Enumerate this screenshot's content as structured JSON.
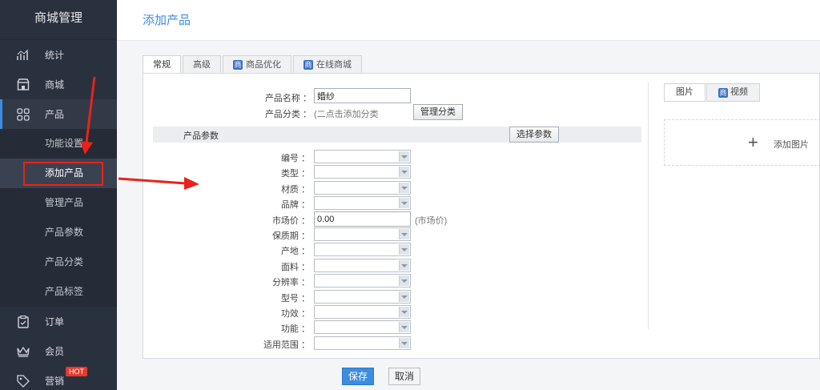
{
  "brand": "商城管理",
  "sidebar": {
    "items": [
      {
        "label": "统计",
        "icon": "chart-icon"
      },
      {
        "label": "商城",
        "icon": "store-icon"
      },
      {
        "label": "产品",
        "icon": "grid-icon"
      },
      {
        "label": "订单",
        "icon": "clipboard-icon"
      },
      {
        "label": "会员",
        "icon": "crown-icon"
      },
      {
        "label": "营销",
        "icon": "tag-icon",
        "badge": "HOT"
      }
    ],
    "sub_items": [
      "功能设置",
      "添加产品",
      "管理产品",
      "产品参数",
      "产品分类",
      "产品标签"
    ]
  },
  "header": {
    "title": "添加产品"
  },
  "tabs": [
    "常规",
    "高级",
    "商品优化",
    "在线商城"
  ],
  "form": {
    "name_label": "产品名称",
    "name_value": "婚纱",
    "category_label": "产品分类",
    "category_hint": "(二点击添加分类",
    "manage_category_btn": "管理分类",
    "params_section": "产品参数",
    "select_params_btn": "选择参数",
    "params": [
      {
        "label": "编号",
        "type": "select"
      },
      {
        "label": "类型",
        "type": "select"
      },
      {
        "label": "材质",
        "type": "select"
      },
      {
        "label": "品牌",
        "type": "select"
      },
      {
        "label": "市场价",
        "type": "text",
        "value": "0.00",
        "hint": "(市场价)"
      },
      {
        "label": "保质期",
        "type": "select"
      },
      {
        "label": "产地",
        "type": "select"
      },
      {
        "label": "面料",
        "type": "select"
      },
      {
        "label": "分辨率",
        "type": "select"
      },
      {
        "label": "型号",
        "type": "select"
      },
      {
        "label": "功效",
        "type": "select"
      },
      {
        "label": "功能",
        "type": "select"
      },
      {
        "label": "适用范围",
        "type": "select"
      }
    ]
  },
  "media": {
    "tabs": [
      "图片",
      "视频"
    ],
    "add_image": "添加图片"
  },
  "footer": {
    "save": "保存",
    "cancel": "取消"
  },
  "colors": {
    "accent": "#3c8dde",
    "sidebar_bg": "#2a313e",
    "annotation_red": "#e8231b"
  }
}
